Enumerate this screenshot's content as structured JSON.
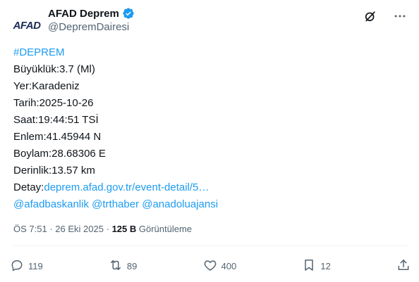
{
  "author": {
    "avatar_text": "AFAD",
    "display_name": "AFAD Deprem",
    "handle": "@DepremDairesi"
  },
  "header_icons": [
    "grok-icon",
    "more-icon"
  ],
  "post": {
    "hashtag": "#DEPREM",
    "lines": [
      "Büyüklük:3.7 (Ml)",
      "Yer:Karadeniz",
      "Tarih:2025-10-26",
      "Saat:19:44:51 TSİ",
      "Enlem:41.45944 N",
      "Boylam:28.68306 E",
      "Derinlik:13.57 km"
    ],
    "detail_label": "Detay:",
    "detail_link": "deprem.afad.gov.tr/event-detail/5…",
    "mentions": [
      "@afadbaskanlik",
      "@trthaber",
      "@anadoluajansi"
    ]
  },
  "meta": {
    "time": "ÖS 7:51",
    "separator": "·",
    "date": "26 Eki 2025",
    "views_count": "125 B",
    "views_label": "Görüntüleme"
  },
  "actions": {
    "replies": "119",
    "reposts": "89",
    "likes": "400",
    "bookmarks": "12"
  },
  "colors": {
    "link": "#1d9bf0",
    "text": "#0f1419",
    "secondary": "#536471",
    "verified": "#1d9bf0"
  }
}
